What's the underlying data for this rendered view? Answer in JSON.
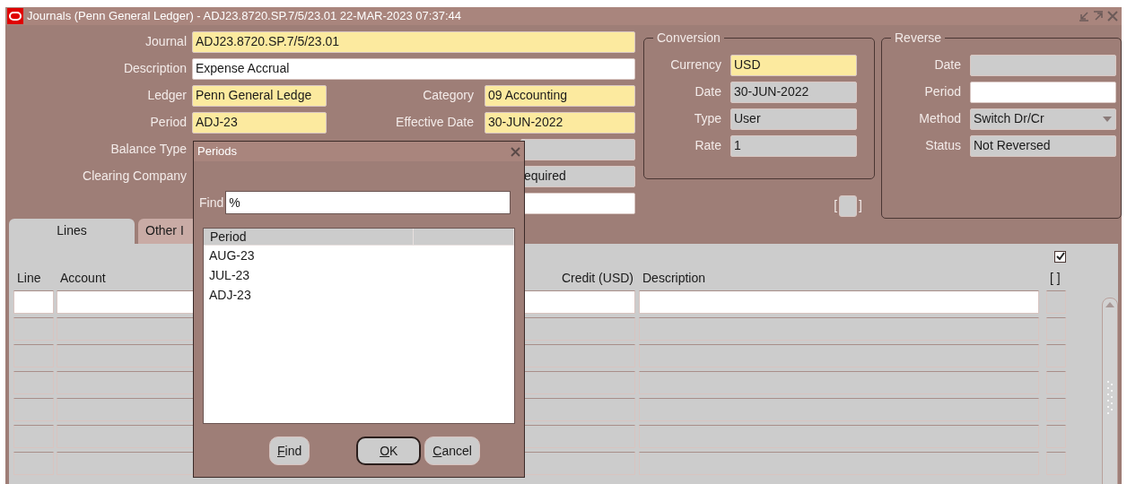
{
  "window": {
    "title": "Journals (Penn General Ledger) - ADJ23.8720.SP.7/5/23.01 22-MAR-2023 07:37:44"
  },
  "header": {
    "rows": [
      {
        "kind": "single",
        "label": "Journal",
        "fields": [
          {
            "value": "ADJ23.8720.SP.7/5/23.01",
            "kind": "required"
          }
        ]
      },
      {
        "kind": "single",
        "label": "Description",
        "fields": [
          {
            "value": "Expense Accrual",
            "kind": "editable"
          }
        ]
      },
      {
        "kind": "pair",
        "label": "Ledger",
        "fields": [
          {
            "value": "Penn General Ledge",
            "kind": "required"
          },
          {
            "label": "Category",
            "value": "09 Accounting",
            "kind": "required"
          }
        ]
      },
      {
        "kind": "pair",
        "label": "Period",
        "fields": [
          {
            "value": "ADJ-23",
            "kind": "required"
          },
          {
            "label": "Effective Date",
            "value": "30-JUN-2022",
            "kind": "required"
          }
        ]
      },
      {
        "kind": "covered",
        "label": "Balance Type",
        "fields": [
          {
            "kind": "readonly"
          }
        ]
      },
      {
        "kind": "covered",
        "label": "Clearing Company",
        "fields": [
          {
            "value": "equired",
            "kind": "readonly"
          }
        ]
      },
      {
        "kind": "covered",
        "fields": [
          {
            "kind": "editable"
          }
        ]
      }
    ]
  },
  "conversion": {
    "title": "Conversion",
    "fields": [
      {
        "label": "Currency",
        "value": "USD",
        "kind": "required"
      },
      {
        "label": "Date",
        "value": "30-JUN-2022",
        "kind": "readonly"
      },
      {
        "label": "Type",
        "value": "User",
        "kind": "readonly"
      },
      {
        "label": "Rate",
        "value": "1",
        "kind": "readonly"
      }
    ]
  },
  "bracket_field": {
    "open": "[",
    "close": "]"
  },
  "reverse": {
    "title": "Reverse",
    "fields": [
      {
        "label": "Date",
        "kind": "readonly"
      },
      {
        "label": "Period",
        "kind": "editable"
      },
      {
        "label": "Method",
        "value": "Switch Dr/Cr",
        "kind": "list"
      },
      {
        "label": "Status",
        "value": "Not Reversed",
        "kind": "readonly"
      }
    ]
  },
  "tabs": [
    {
      "label": "Lines",
      "selected": true
    },
    {
      "label": "Other I",
      "selected": false
    }
  ],
  "lines": {
    "select_all": {
      "checked": true
    },
    "columns": [
      {
        "label": "Line",
        "kind": "text"
      },
      {
        "label": "Account",
        "kind": "text"
      },
      {
        "kind": "text"
      },
      {
        "label": "Credit (USD)",
        "kind": "amount"
      },
      {
        "label": "Description",
        "kind": "text"
      },
      {
        "label": "[ ]",
        "kind": "text"
      }
    ],
    "rows": [
      {
        "selected": true
      },
      {
        "selected": false
      },
      {
        "selected": false
      },
      {
        "selected": false
      },
      {
        "selected": false
      },
      {
        "selected": false
      },
      {
        "selected": false
      }
    ]
  },
  "dialog": {
    "title": "Periods",
    "find": {
      "label": "Find",
      "value": "%"
    },
    "list": {
      "columns": [
        {
          "label": "Period"
        },
        {}
      ],
      "items": [
        "AUG-23",
        "JUL-23",
        "ADJ-23"
      ]
    },
    "buttons": [
      {
        "label": "Find",
        "default": false
      },
      {
        "label": "OK",
        "default": true
      },
      {
        "label": "Cancel",
        "default": false
      }
    ]
  }
}
